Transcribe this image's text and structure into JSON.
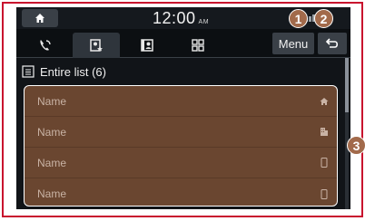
{
  "statusbar": {
    "time": "12:00",
    "ampm": "AM",
    "home_icon": "home-icon"
  },
  "tabs": [
    {
      "icon": "phone-call-icon",
      "active": false
    },
    {
      "icon": "contacts-star-icon",
      "active": true
    },
    {
      "icon": "phonebook-icon",
      "active": false
    },
    {
      "icon": "keypad-icon",
      "active": false
    }
  ],
  "toolbar": {
    "menu_label": "Menu",
    "back_icon": "back-arrow-icon"
  },
  "list": {
    "header": "Entire list (6)",
    "items": [
      {
        "label": "Name",
        "icon": "home-icon"
      },
      {
        "label": "Name",
        "icon": "office-icon"
      },
      {
        "label": "Name",
        "icon": "mobile-icon"
      },
      {
        "label": "Name",
        "icon": "mobile-icon"
      }
    ]
  },
  "callouts": [
    "1",
    "2",
    "3"
  ],
  "colors": {
    "frame": "#c8102e",
    "list_bg": "#6a4630",
    "callout": "#a26a4b"
  }
}
